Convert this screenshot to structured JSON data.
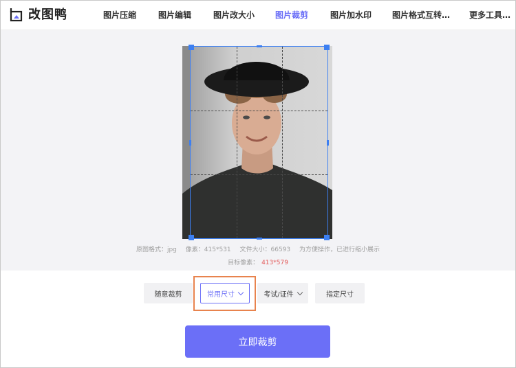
{
  "header": {
    "logo_text": "改图鸭",
    "nav": [
      {
        "label": "图片压缩"
      },
      {
        "label": "图片编辑"
      },
      {
        "label": "图片改大小"
      },
      {
        "label": "图片裁剪"
      },
      {
        "label": "图片加水印"
      },
      {
        "label": "图片格式互转…"
      },
      {
        "label": "更多工具…"
      }
    ],
    "active_nav": "图片裁剪"
  },
  "image_info": {
    "format": "原图格式：jpg",
    "pixels": "像素：415*531",
    "file_size": "文件大小：66593",
    "note": "为方便操作，已进行缩小展示",
    "target_label": "目标像素：",
    "target_value": "413*579"
  },
  "crop_options": [
    {
      "label": "随意裁剪",
      "has_dropdown": false
    },
    {
      "label": "常用尺寸",
      "has_dropdown": true,
      "selected": true
    },
    {
      "label": "考试/证件",
      "has_dropdown": true
    },
    {
      "label": "指定尺寸",
      "has_dropdown": false
    }
  ],
  "action": {
    "crop_label": "立即裁剪"
  },
  "colors": {
    "accent": "#6b6ff7",
    "crop_border": "#3c7ff2",
    "highlight": "#e8834d",
    "target_red": "#e35a5a"
  }
}
